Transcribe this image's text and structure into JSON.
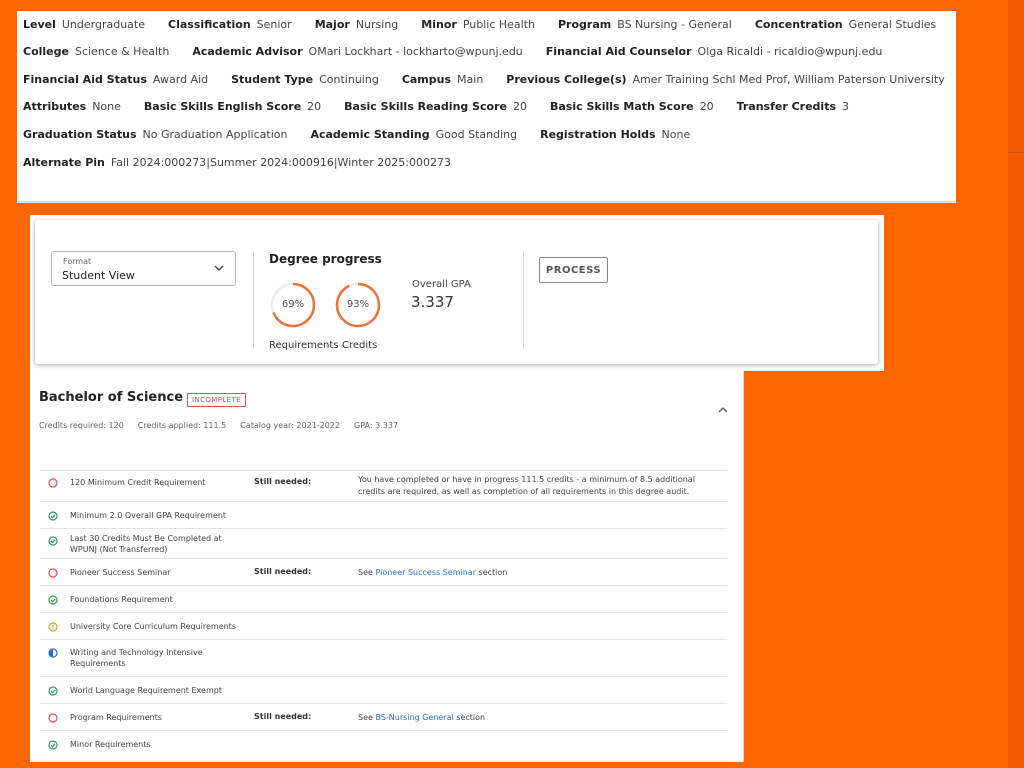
{
  "student_info": {
    "rows": [
      [
        {
          "k": "Level",
          "v": "Undergraduate"
        },
        {
          "k": "Classification",
          "v": "Senior"
        },
        {
          "k": "Major",
          "v": "Nursing"
        },
        {
          "k": "Minor",
          "v": "Public Health"
        },
        {
          "k": "Program",
          "v": "BS Nursing - General"
        },
        {
          "k": "Concentration",
          "v": "General Studies"
        }
      ],
      [
        {
          "k": "College",
          "v": "Science & Health"
        },
        {
          "k": "Academic Advisor",
          "v": "OMari Lockhart - lockharto@wpunj.edu"
        },
        {
          "k": "Financial Aid Counselor",
          "v": "Olga Ricaldi - ricaldio@wpunj.edu"
        }
      ],
      [
        {
          "k": "Financial Aid Status",
          "v": "Award Aid"
        },
        {
          "k": "Student Type",
          "v": "Continuing"
        },
        {
          "k": "Campus",
          "v": "Main"
        },
        {
          "k": "Previous College(s)",
          "v": "Amer Training Schl Med Prof, William Paterson University"
        }
      ],
      [
        {
          "k": "Attributes",
          "v": "None"
        },
        {
          "k": "Basic Skills English Score",
          "v": "20"
        },
        {
          "k": "Basic Skills Reading Score",
          "v": "20"
        },
        {
          "k": "Basic Skills Math Score",
          "v": "20"
        },
        {
          "k": "Transfer Credits",
          "v": "3"
        }
      ],
      [
        {
          "k": "Graduation Status",
          "v": "No Graduation Application"
        },
        {
          "k": "Academic Standing",
          "v": "Good Standing"
        },
        {
          "k": "Registration Holds",
          "v": "None"
        }
      ],
      [
        {
          "k": "Alternate Pin",
          "v": "Fall 2024:000273|Summer 2024:000916|Winter 2025:000273"
        }
      ]
    ]
  },
  "format": {
    "label": "Format",
    "value": "Student View"
  },
  "degree_progress": {
    "title": "Degree progress",
    "requirements": {
      "percent_text": "69%",
      "percent": 69,
      "label": "Requirements"
    },
    "credits": {
      "percent_text": "93%",
      "percent": 93,
      "label": "Credits"
    },
    "gpa_label": "Overall GPA",
    "gpa_value": "3.337",
    "ring_color": "#e8733a"
  },
  "process_button": "PROCESS",
  "degree": {
    "title": "Bachelor of Science",
    "status": "INCOMPLETE",
    "credits_required": "Credits required:  120",
    "credits_applied": "Credits applied:  111.5",
    "catalog_year": "Catalog year:  2021-2022",
    "gpa": "GPA:  3.337"
  },
  "requirements": [
    {
      "status": "not-met",
      "name": "120 Minimum Credit Requirement",
      "still": "Still needed:",
      "desc": "You have completed or have in progress 111.5 credits - a minimum of 8.5 additional credits are required, as well as completion of all requirements in this degree audit."
    },
    {
      "status": "met",
      "name": "Minimum 2.0 Overall GPA Requirement",
      "still": "",
      "desc": ""
    },
    {
      "status": "met",
      "name": "Last 30 Credits Must Be Completed at WPUNJ (Not Transferred)",
      "still": "",
      "desc": ""
    },
    {
      "status": "not-met",
      "name": "Pioneer Success Seminar",
      "still": "Still needed:",
      "desc_pre": "See ",
      "desc_link": "Pioneer Success Seminar",
      "desc_post": " section"
    },
    {
      "status": "met",
      "name": "Foundations Requirement",
      "still": "",
      "desc": ""
    },
    {
      "status": "in-progress",
      "name": "University Core Curriculum Requirements",
      "still": "",
      "desc": ""
    },
    {
      "status": "half",
      "name": "Writing and Technology Intensive Requirements",
      "still": "",
      "desc": ""
    },
    {
      "status": "met",
      "name": "World Language Requirement Exempt",
      "still": "",
      "desc": ""
    },
    {
      "status": "not-met",
      "name": "Program Requirements",
      "still": "Still needed:",
      "desc_pre": "See ",
      "desc_link": "BS-Nursing General",
      "desc_post": " section"
    },
    {
      "status": "met",
      "name": "Minor Requirements",
      "still": "",
      "desc": ""
    }
  ],
  "colors": {
    "accent": "#ff6600",
    "met": "#2e9e5b",
    "not_met": "#d9534f",
    "in_progress": "#c9a227",
    "half": "#2a6ebb",
    "link": "#2a6ebb"
  }
}
